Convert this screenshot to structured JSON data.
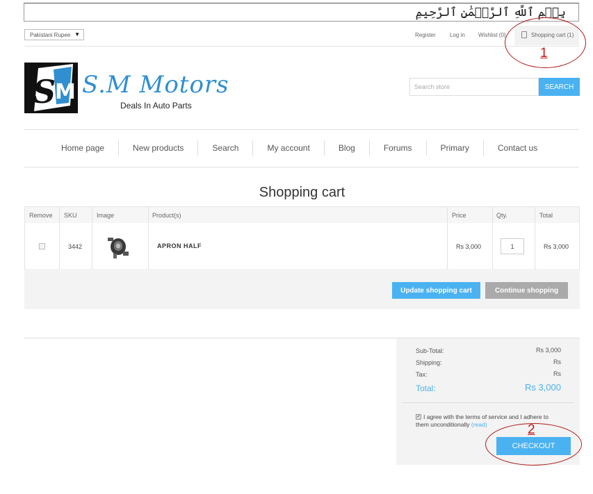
{
  "banner": {
    "calligraphy": "بِسۡمِ ٱللَّهِ ٱلرَّحۡمَٰنِ ٱلرَّحِيمِ"
  },
  "header": {
    "currency": "Pakistani Rupee",
    "links": {
      "register": "Register",
      "login": "Log in",
      "wishlist": "Wishlist (0)",
      "cart": "Shopping cart (1)"
    }
  },
  "logo": {
    "name": "S.M Motors",
    "tagline": "Deals In Auto Parts",
    "mark_letters": "SM"
  },
  "search": {
    "placeholder": "Search store",
    "button": "SEARCH"
  },
  "nav": {
    "items": [
      "Home page",
      "New products",
      "Search",
      "My account",
      "Blog",
      "Forums",
      "Primary",
      "Contact us"
    ]
  },
  "page": {
    "title": "Shopping cart"
  },
  "cart": {
    "headers": {
      "remove": "Remove",
      "sku": "SKU",
      "image": "Image",
      "product": "Product(s)",
      "price": "Price",
      "qty": "Qty.",
      "total": "Total"
    },
    "rows": [
      {
        "sku": "3442",
        "product": "APRON HALF",
        "price": "Rs 3,000",
        "qty": "1",
        "total": "Rs 3,000"
      }
    ],
    "update_button": "Update shopping cart",
    "continue_button": "Continue shopping"
  },
  "totals": {
    "subtotal_label": "Sub-Total:",
    "subtotal_value": "Rs 3,000",
    "shipping_label": "Shipping:",
    "shipping_value": "Rs",
    "tax_label": "Tax:",
    "tax_value": "Rs",
    "total_label": "Total:",
    "total_value": "Rs 3,000",
    "terms_text": "I agree with the terms of service and I adhere to them unconditionally",
    "terms_link": "(read)",
    "terms_checked": true,
    "checkout_button": "CHECKOUT"
  },
  "annotations": {
    "first": "1",
    "second": "2"
  },
  "colors": {
    "accent": "#4ab2f1",
    "annotation": "#c01818",
    "logo_blue": "#2f8fd0"
  }
}
